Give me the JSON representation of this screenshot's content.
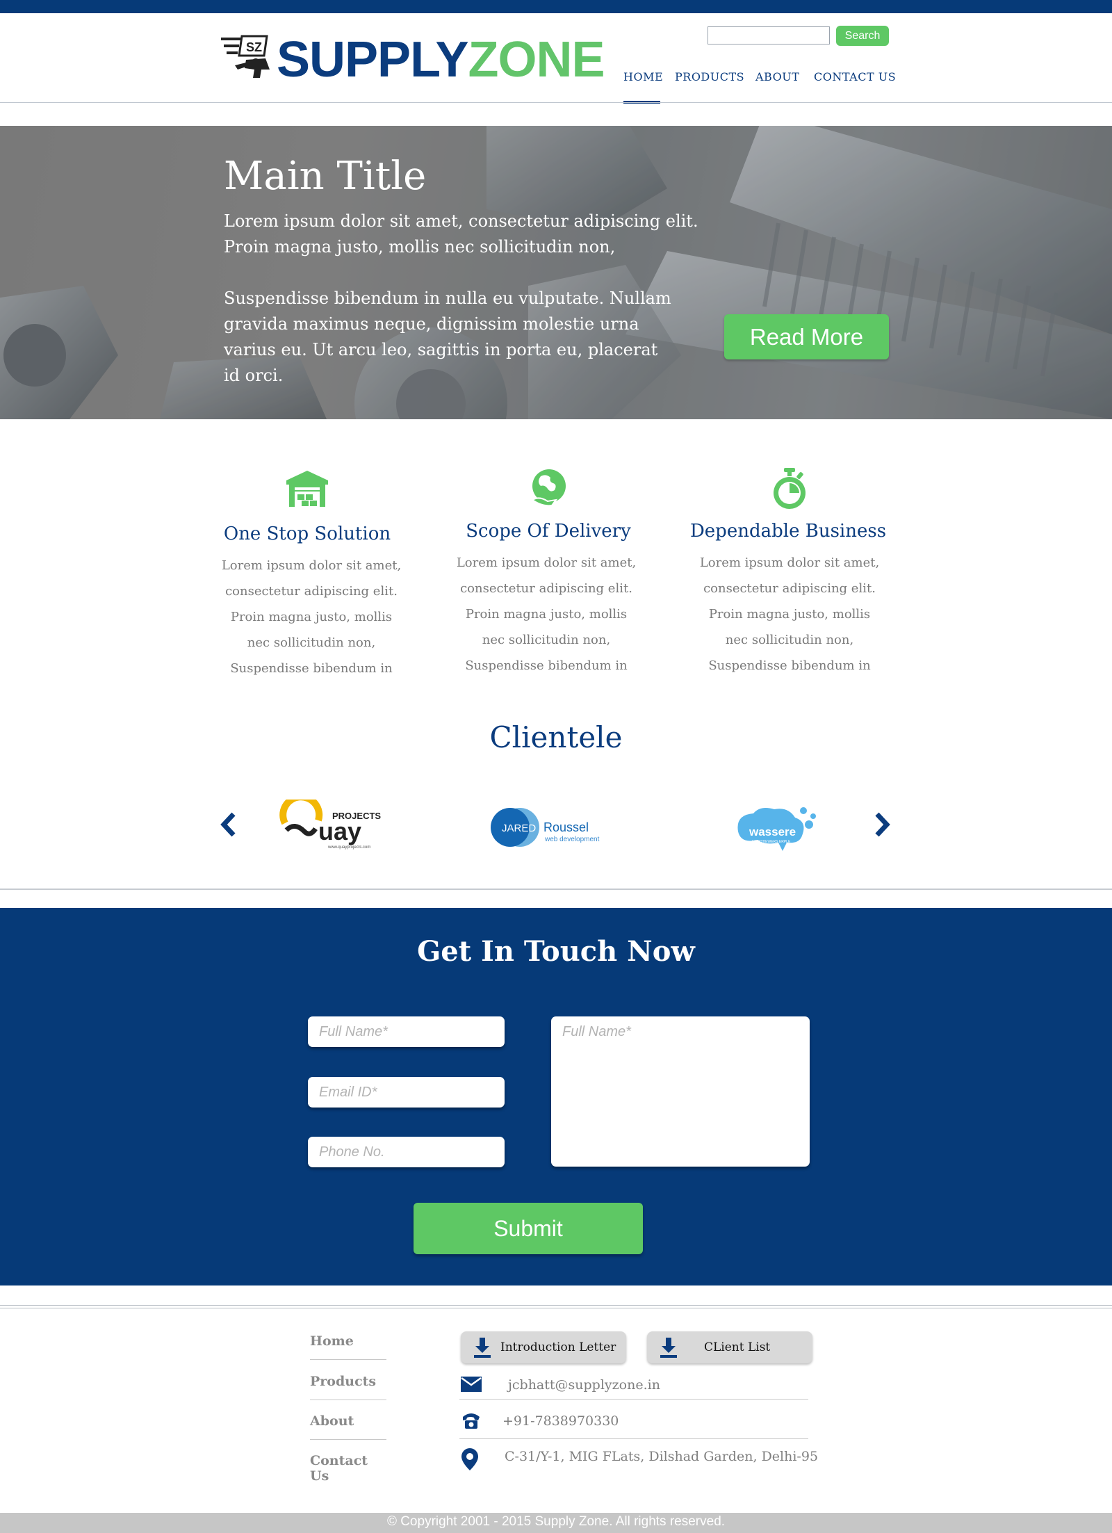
{
  "header": {
    "logo": {
      "part1": "SUPPLY",
      "part2": "ZONE",
      "mark_text": "SZ"
    },
    "search": {
      "value": "",
      "button_label": "Search"
    },
    "nav": [
      {
        "label": "HOME",
        "active": true
      },
      {
        "label": "PRODUCTS",
        "active": false
      },
      {
        "label": "ABOUT",
        "active": false
      },
      {
        "label": "CONTACT US",
        "active": false
      }
    ]
  },
  "hero": {
    "title": "Main Title",
    "paragraph1": [
      "Lorem ipsum dolor sit amet, consectetur adipiscing elit.",
      "Proin magna justo, mollis nec sollicitudin non,"
    ],
    "paragraph2": [
      "Suspendisse bibendum in nulla eu vulputate. Nullam",
      "gravida maximus neque, dignissim molestie urna",
      "varius eu. Ut arcu leo, sagittis in porta eu, placerat",
      "id orci."
    ],
    "button_label": "Read More"
  },
  "features": [
    {
      "icon": "warehouse-icon",
      "title": "One Stop Solution",
      "lines": [
        "Lorem ipsum dolor sit amet,",
        "consectetur adipiscing elit.",
        "Proin magna justo, mollis",
        "nec sollicitudin non,",
        "Suspendisse bibendum in"
      ]
    },
    {
      "icon": "globe-delivery-icon",
      "title": "Scope Of Delivery",
      "lines": [
        "Lorem ipsum dolor sit amet,",
        "consectetur adipiscing elit.",
        "Proin magna justo, mollis",
        "nec sollicitudin non,",
        "Suspendisse bibendum in"
      ]
    },
    {
      "icon": "stopwatch-icon",
      "title": "Dependable Business",
      "lines": [
        "Lorem ipsum dolor sit amet,",
        "consectetur adipiscing elit.",
        "Proin magna justo, mollis",
        "nec sollicitudin non,",
        "Suspendisse bibendum in"
      ]
    }
  ],
  "clientele": {
    "title": "Clientele",
    "clients": [
      {
        "name": "Quay Projects",
        "logo_text": "uay",
        "sub": "PROJECTS",
        "url": "www.quayprojects.com"
      },
      {
        "name": "Jared Roussel",
        "logo_text1": "JARED",
        "logo_text2": "Roussel",
        "sub": "web development"
      },
      {
        "name": "wassere",
        "logo_text": "wassere",
        "sub": "UMWTHEWERS ERPLE"
      }
    ]
  },
  "contact": {
    "title": "Get In Touch Now",
    "fields": {
      "name_placeholder": "Full Name*",
      "email_placeholder": "Email ID*",
      "phone_placeholder": "Phone No.",
      "message_placeholder": "Full Name*"
    },
    "submit_label": "Submit"
  },
  "footer": {
    "nav": [
      "Home",
      "Products",
      "About",
      "Contact Us"
    ],
    "downloads": [
      "Introduction Letter",
      "CLient List"
    ],
    "email": "jcbhatt@supplyzone.in",
    "phone": "+91-7838970330",
    "address": "C-31/Y-1, MIG FLats, Dilshad Garden, Delhi-95",
    "copyright": "© Copyright 2001 - 2015 Supply Zone. All rights reserved."
  },
  "colors": {
    "navy": "#063a78",
    "green": "#5ec864",
    "gray_text": "#7a7a7a"
  }
}
